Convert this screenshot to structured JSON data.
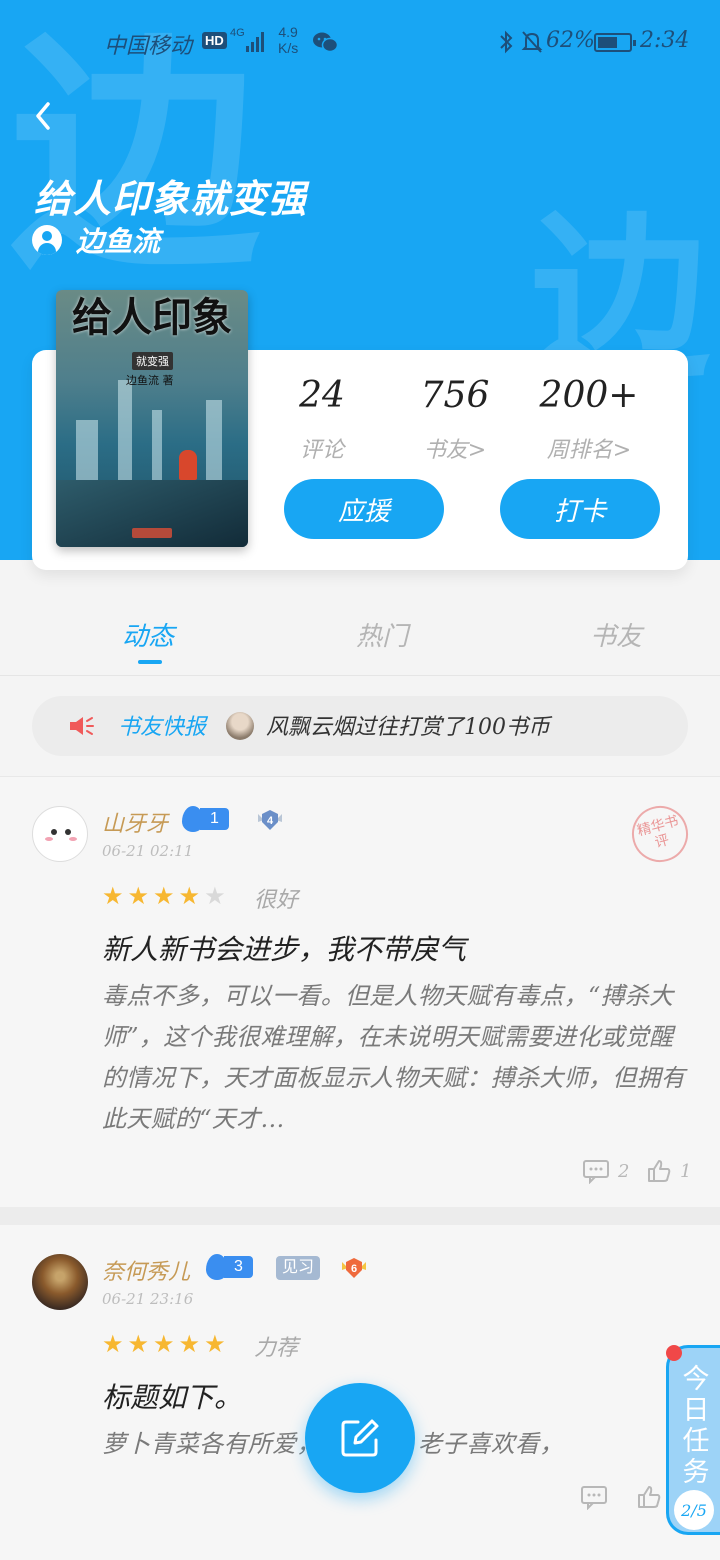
{
  "status_bar": {
    "carrier": "中国移动",
    "hd": "HD",
    "network": "4G",
    "speed_value": "4.9",
    "speed_unit": "K/s",
    "battery": "62%",
    "battery_level": 0.62,
    "time": "2:34"
  },
  "header": {
    "watermark_char": "边",
    "book_title": "给人印象就变强",
    "author": "边鱼流"
  },
  "cover": {
    "title": "给人印象",
    "subtitle": "就变强",
    "author": "边鱼流 著"
  },
  "stats": [
    {
      "value": "24",
      "label": "评论"
    },
    {
      "value": "756",
      "label": "书友>"
    },
    {
      "value": "200+",
      "label": "周排名>"
    }
  ],
  "actions": {
    "support": "应援",
    "checkin": "打卡"
  },
  "tabs": [
    "动态",
    "热门",
    "书友"
  ],
  "news": {
    "label": "书友快报",
    "text": "风飘云烟过往打赏了100书币"
  },
  "posts": [
    {
      "username": "山牙牙",
      "level": "1",
      "medal": "4",
      "time": "06-21 02:11",
      "stamp": "精华书评",
      "rating": 4,
      "rating_text": "很好",
      "title": "新人新书会进步，我不带戾气",
      "body": "毒点不多，可以一看。但是人物天赋有毒点，“搏杀大师”，这个我很难理解，在未说明天赋需要进化或觉醒的情况下，天才面板显示人物天赋：搏杀大师，但拥有此天赋的“天才…",
      "comments": "2",
      "likes": "1"
    },
    {
      "username": "奈何秀儿",
      "level": "3",
      "badge": "见习",
      "medal": "6",
      "time": "06-21 23:16",
      "rating": 5,
      "rating_text": "力荐",
      "title": "标题如下。",
      "body": "萝卜青菜各有所爱，请别喷！老子喜欢看，",
      "comments": "",
      "likes": ""
    }
  ],
  "daily_task": {
    "label": "今日任务",
    "progress": "2/5"
  },
  "colors": {
    "primary": "#18a6f3",
    "username": "#c69a55",
    "star": "#f7b731"
  }
}
